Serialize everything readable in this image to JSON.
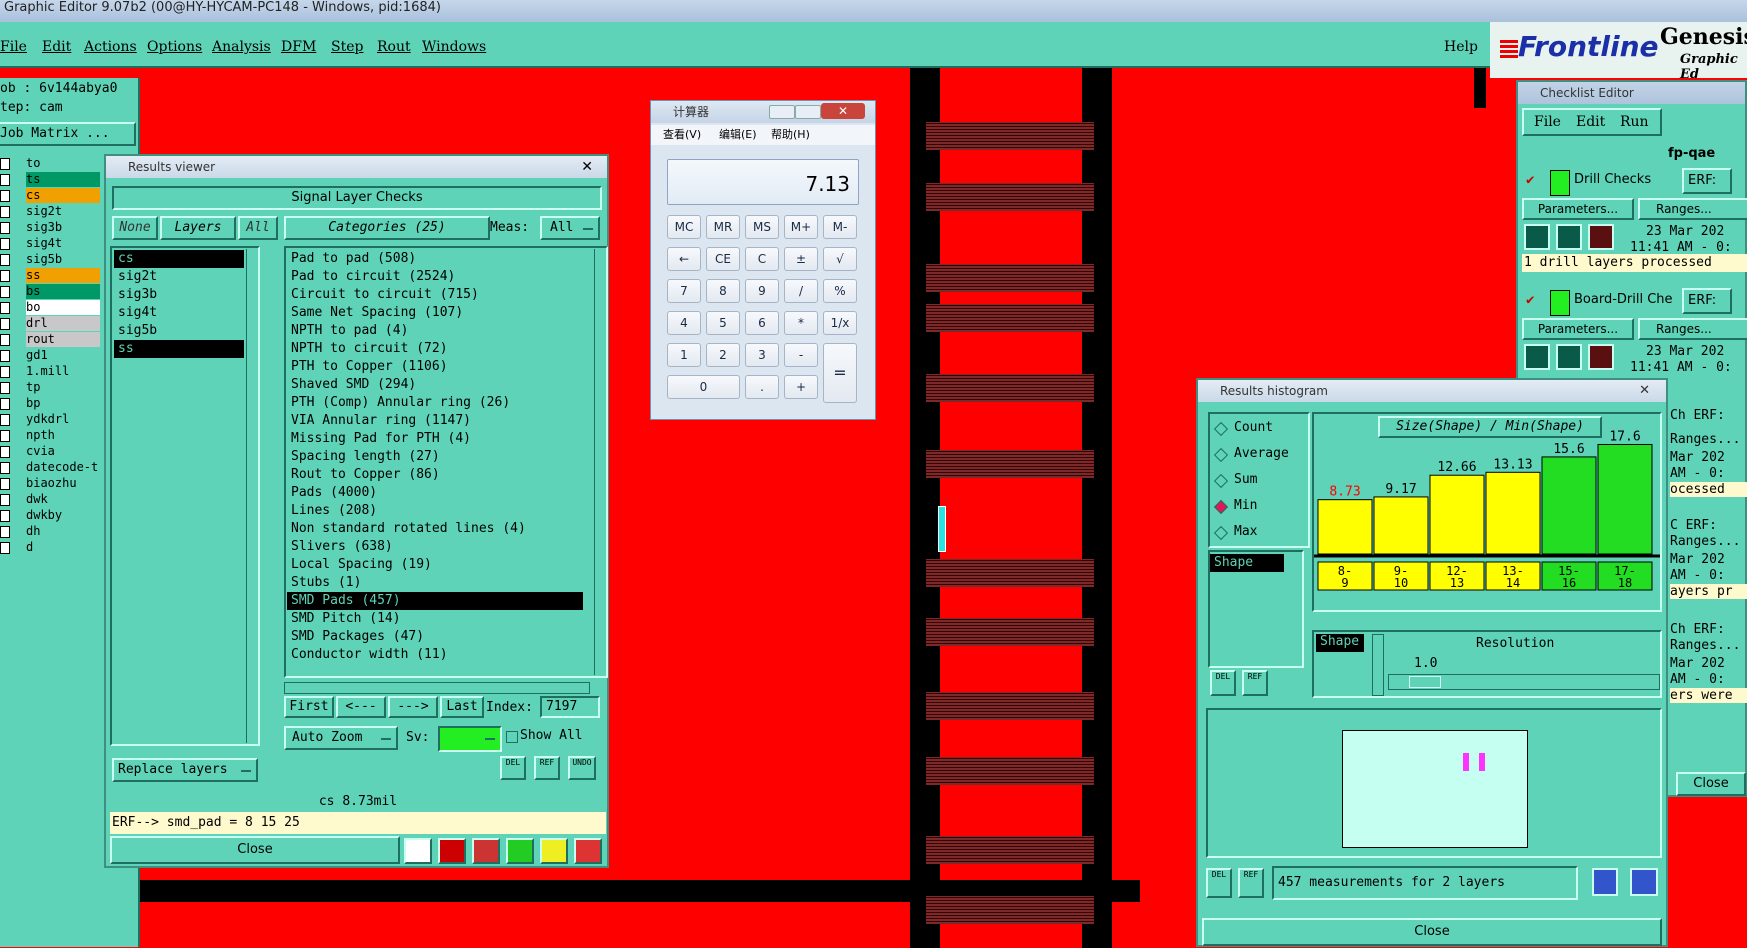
{
  "window_title": "Graphic Editor 9.07b2 (00@HY-HYCAM-PC148 - Windows, pid:1684)",
  "menu": [
    "File",
    "Edit",
    "Actions",
    "Options",
    "Analysis",
    "DFM",
    "Step",
    "Rout",
    "Windows"
  ],
  "help": "Help",
  "brand": {
    "frontline": "Frontline",
    "genesis": "Genesis",
    "sub": "Graphic Ed"
  },
  "job_info": {
    "job": "ob : 6v144abya0",
    "step": "tep: cam",
    "matrix": "Job Matrix ..."
  },
  "layers_panel": [
    "to",
    "ts",
    "cs",
    "sig2t",
    "sig3b",
    "sig4t",
    "sig5b",
    "ss",
    "bs",
    "bo",
    "drl",
    "rout",
    "gd1",
    "1.mill",
    "tp",
    "bp",
    "ydkdrl",
    "npth",
    "cvia",
    "datecode-t",
    "biaozhu",
    "dwk",
    "dwkby",
    "dh",
    "d"
  ],
  "results_viewer": {
    "title": "Results viewer",
    "header": "Signal Layer Checks",
    "none": "None",
    "layers": "Layers",
    "all": "All",
    "categories_btn": "Categories (25)",
    "meas_label": "Meas:",
    "meas_value": "All",
    "layer_list": [
      "cs",
      "sig2t",
      "sig3b",
      "sig4t",
      "sig5b",
      "ss"
    ],
    "categories": [
      "Pad to pad (508)",
      "Pad to circuit (2524)",
      "Circuit to circuit (715)",
      "Same Net Spacing (107)",
      "NPTH to pad (4)",
      "NPTH to circuit (72)",
      "PTH to Copper (1106)",
      "Shaved SMD (294)",
      "PTH (Comp) Annular ring (26)",
      "VIA Annular ring (1147)",
      "Missing Pad for PTH (4)",
      "Spacing length (27)",
      "Rout to Copper (86)",
      "Pads (4000)",
      "Lines (208)",
      "Non standard rotated lines (4)",
      "Slivers (638)",
      "Local Spacing (19)",
      "Stubs (1)",
      "SMD Pads (457)",
      "SMD Pitch (14)",
      "SMD Packages (47)",
      "Conductor width (11)"
    ],
    "nav": {
      "first": "First",
      "prev": "<---",
      "next": "--->",
      "last": "Last",
      "index_label": "Index:",
      "index_value": "7197"
    },
    "auto_zoom": "Auto Zoom",
    "sv": "Sv:",
    "show_all": "Show All",
    "replace_layers": "Replace layers",
    "del": "DEL",
    "ref": "REF",
    "undo": "UNDO",
    "status": "cs 8.73mil",
    "erf": "ERF--> smd_pad = 8 15 25",
    "close": "Close"
  },
  "calculator": {
    "title": "计算器",
    "menu": [
      "查看(V)",
      "编辑(E)",
      "帮助(H)"
    ],
    "display": "7.13",
    "rows": [
      [
        "MC",
        "MR",
        "MS",
        "M+",
        "M-"
      ],
      [
        "←",
        "CE",
        "C",
        "±",
        "√"
      ],
      [
        "7",
        "8",
        "9",
        "/",
        "%"
      ],
      [
        "4",
        "5",
        "6",
        "*",
        "1/x"
      ],
      [
        "1",
        "2",
        "3",
        "-"
      ],
      [
        "0",
        ".",
        " +"
      ]
    ],
    "equals": "="
  },
  "checklist": {
    "title": "Checklist Editor",
    "menu": [
      "File",
      "Edit",
      "Run"
    ],
    "name": "fp-qae",
    "items": [
      {
        "label": "Drill Checks",
        "erf": "ERF:",
        "date": "23 Mar 202",
        "time": "11:41 AM - 0:",
        "status": "1 drill layers processed"
      },
      {
        "label": "Board-Drill Che",
        "erf": "ERF:",
        "date": "23 Mar 202",
        "time": "11:41 AM - 0:",
        "status": "ed"
      }
    ],
    "params": "Parameters...",
    "ranges": "Ranges...",
    "partial": [
      "Ch ERF:",
      "Ranges...",
      "Mar 202",
      "AM - 0:",
      "ocessed",
      "C ERF:",
      "Ranges...",
      "Mar 202",
      "AM - 0:",
      "ayers pr",
      "Ch ERF:",
      "Ranges...",
      "Mar 202",
      "AM - 0:",
      "ers were"
    ],
    "close": "Close"
  },
  "histogram": {
    "title": "Results histogram",
    "modes": [
      "Count",
      "Average",
      "Sum",
      "Min",
      "Max"
    ],
    "selected_mode": "Min",
    "shape_label": "Shape",
    "chart_title": "Size(Shape) / Min(Shape)",
    "bins": [
      {
        "range": "8-9",
        "value": 8.73,
        "label": "8.73",
        "color": "#ffff00",
        "label_color": "#ff0000"
      },
      {
        "range": "9-10",
        "value": 9.17,
        "label": "9.17",
        "color": "#ffff00",
        "label_color": "#000000"
      },
      {
        "range": "12-13",
        "value": 12.66,
        "label": "12.66",
        "color": "#ffff00",
        "label_color": "#000000"
      },
      {
        "range": "13-14",
        "value": 13.13,
        "label": "13.13",
        "color": "#ffff00",
        "label_color": "#000000"
      },
      {
        "range": "15-16",
        "value": 15.6,
        "label": "15.6",
        "color": "#22dd22",
        "label_color": "#000000"
      },
      {
        "range": "17-18",
        "value": 17.6,
        "label": "17.6",
        "color": "#22dd22",
        "label_color": "#000000"
      }
    ],
    "bin_labels_top": [
      "8-",
      "9-",
      "12-",
      "13-",
      "15-",
      "17-"
    ],
    "bin_labels_bottom": [
      "9",
      "10",
      "13",
      "14",
      "16",
      "18"
    ],
    "resolution_label": "Resolution",
    "resolution_value": "1.0",
    "measurements": "457 measurements for 2 layers",
    "del": "DEL",
    "ref": "REF",
    "close": "Close"
  },
  "colors": {
    "teal": "#5ed3b7",
    "pcb_red": "#ff0000",
    "dark_teal": "#1f6f60",
    "highlight": "#000000"
  }
}
